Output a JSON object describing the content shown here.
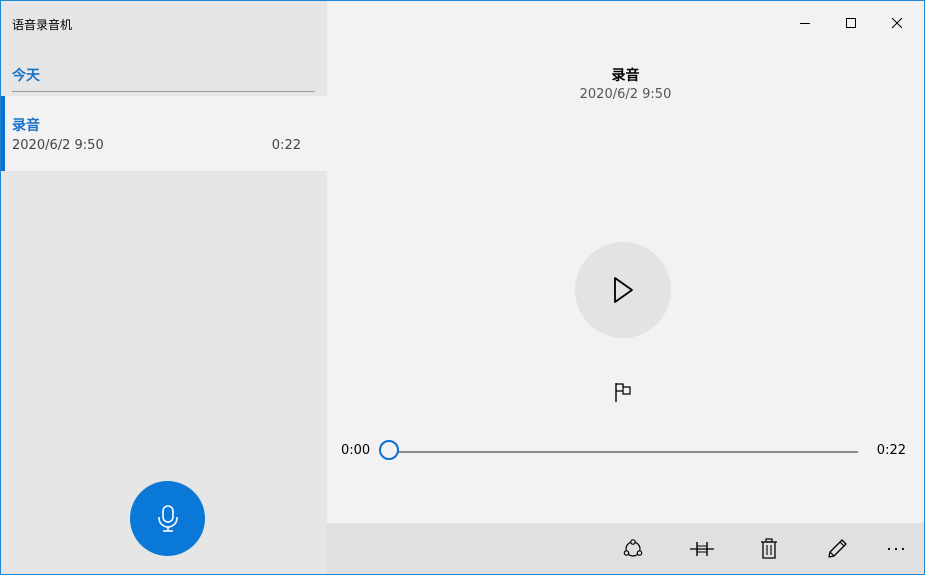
{
  "app": {
    "title": "语音录音机"
  },
  "window_controls": {
    "minimize_icon": "minimize-icon",
    "maximize_icon": "maximize-icon",
    "close_icon": "close-icon"
  },
  "recordings": {
    "group_label": "今天",
    "items": [
      {
        "name": "录音",
        "date": "2020/6/2 9:50",
        "duration": "0:22",
        "selected": true
      }
    ]
  },
  "detail": {
    "title": "录音",
    "date": "2020/6/2 9:50",
    "play_icon": "play-icon",
    "flag_icon": "flag-icon"
  },
  "playback": {
    "current_time": "0:00",
    "total_time": "0:22",
    "progress": 0
  },
  "toolbar": {
    "icons": [
      "share-icon",
      "trim-icon",
      "delete-icon",
      "rename-icon",
      "more-icon"
    ]
  },
  "record_button": {
    "icon": "microphone-icon"
  },
  "colors": {
    "accent": "#0a78d6",
    "left_pane": "#e6e6e6",
    "right_pane": "#f2f2f2",
    "command_bar": "#e0e0e0"
  }
}
